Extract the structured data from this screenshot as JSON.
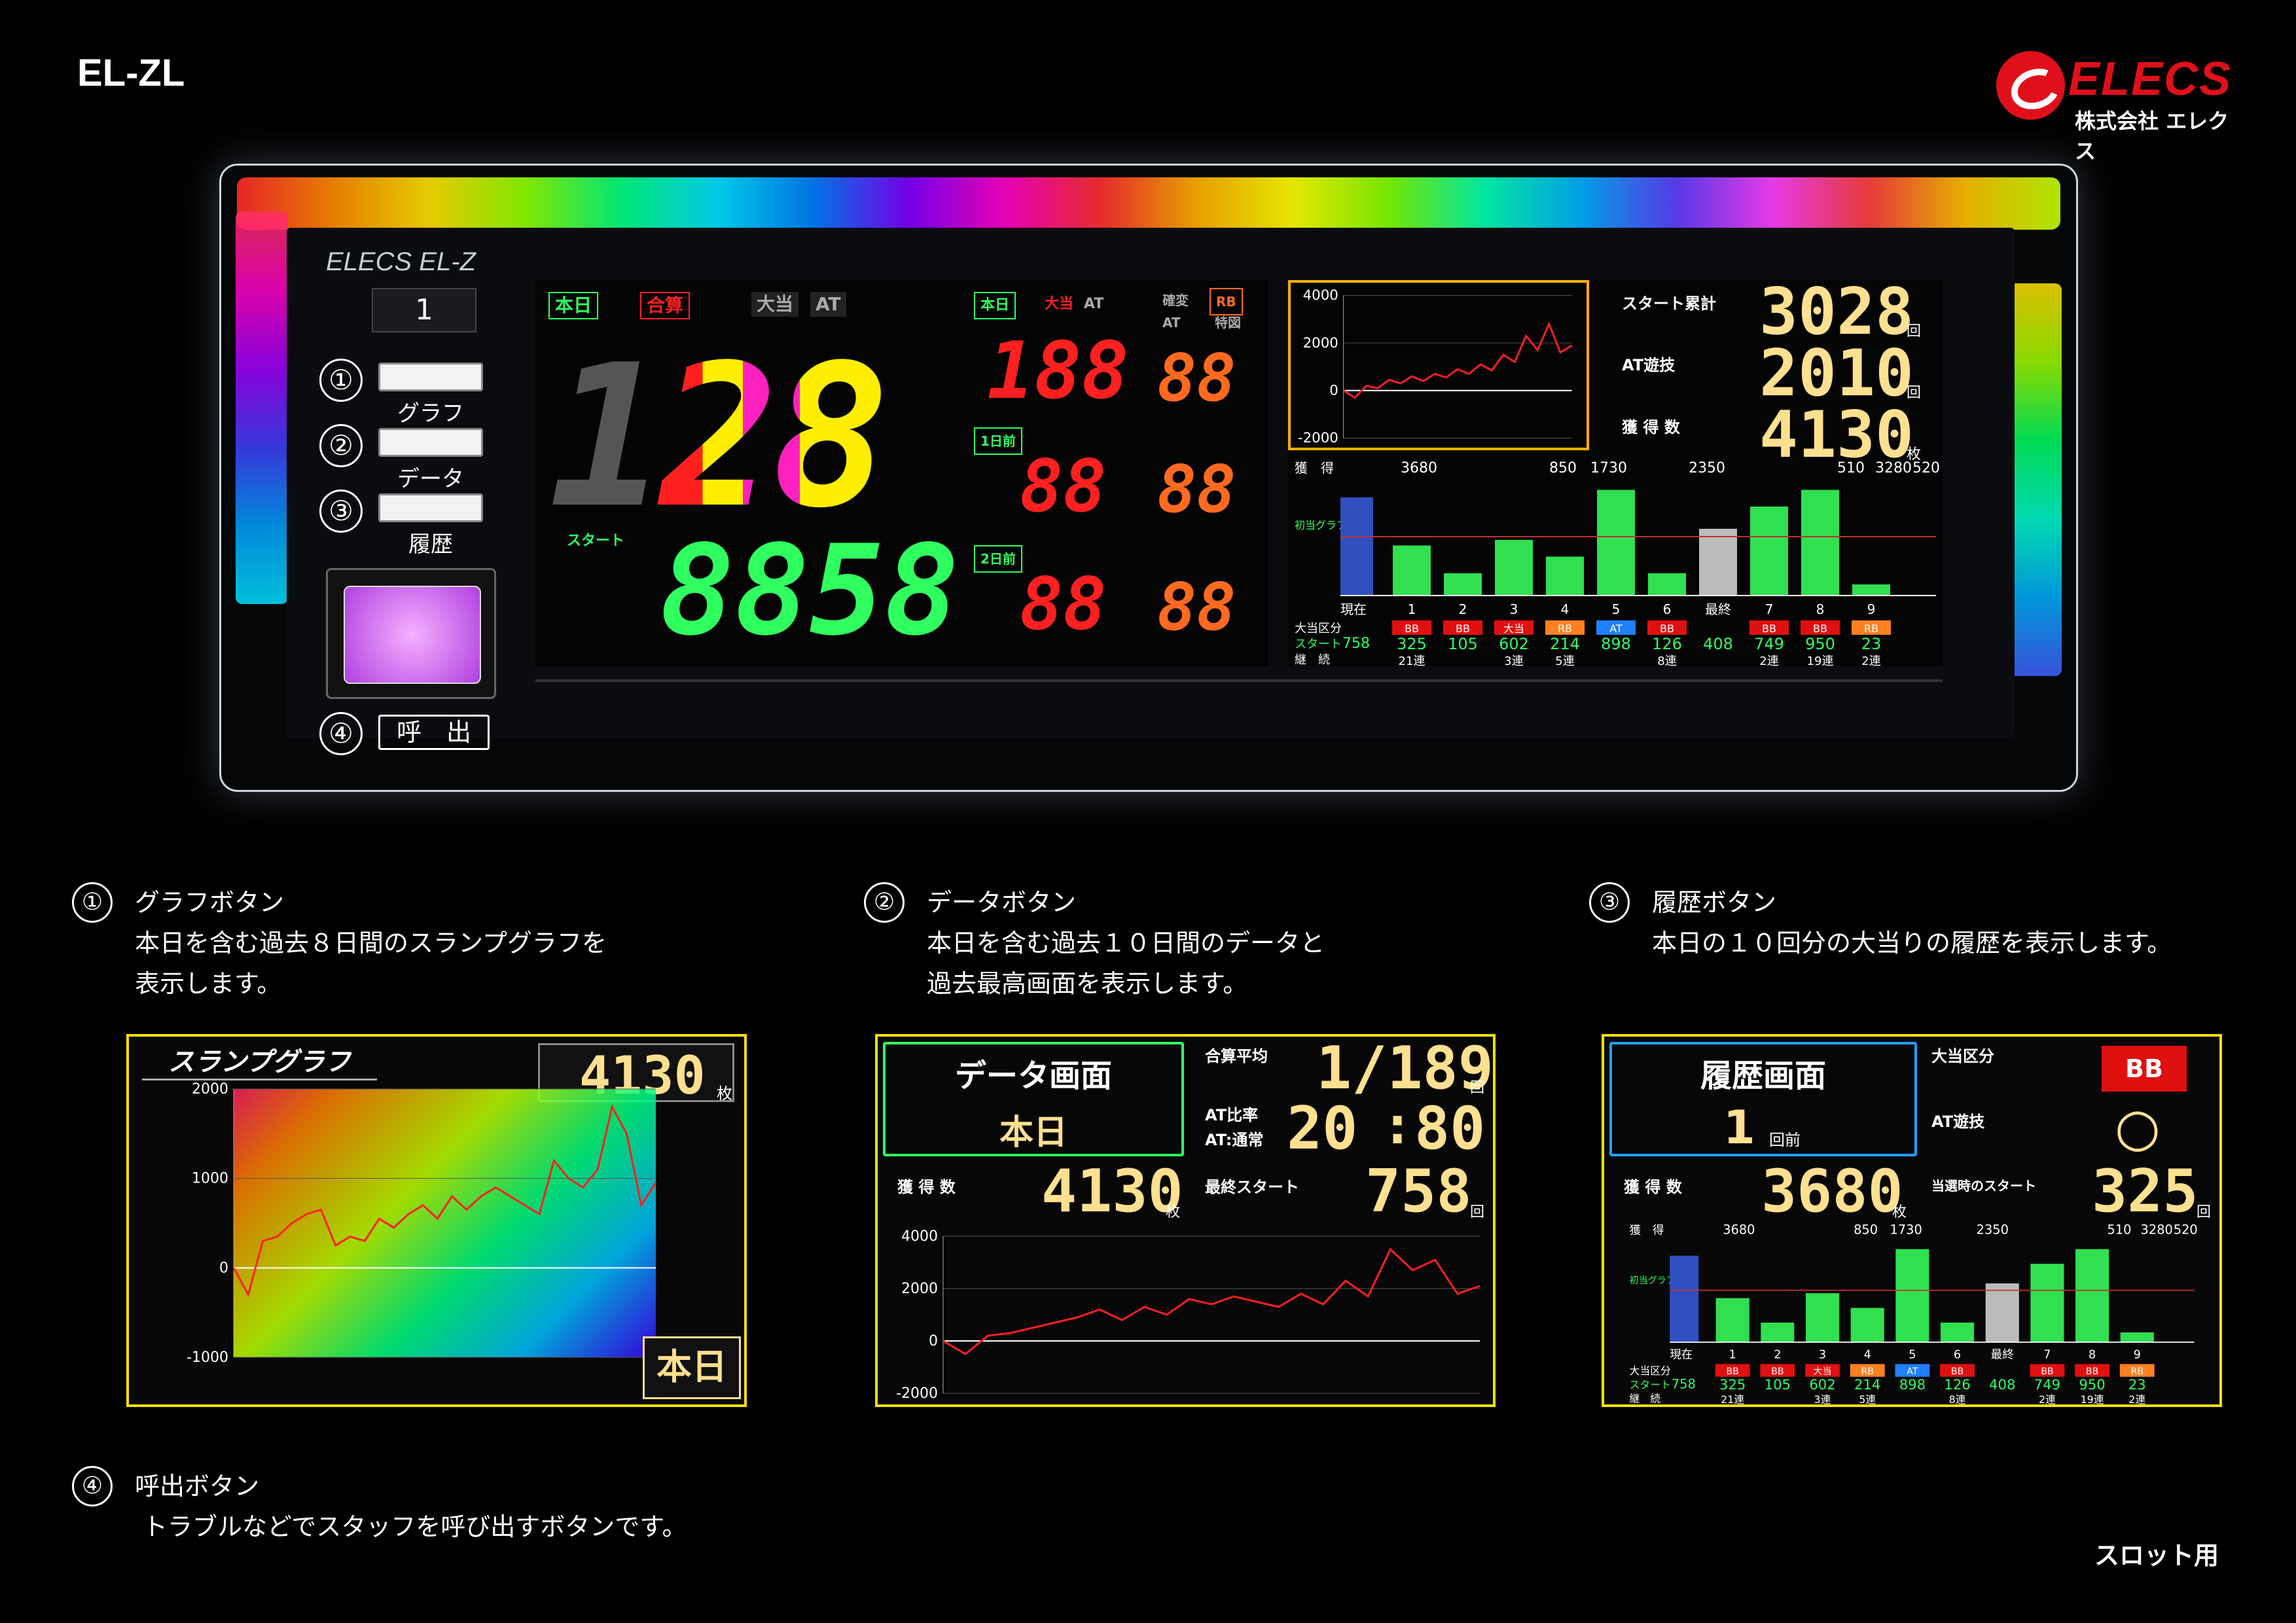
{
  "header": {
    "model": "EL-ZL",
    "logo_word": "ELECS",
    "logo_sub": "株式会社 エレクス"
  },
  "device": {
    "brand": "ELECS EL-Z",
    "unit_number": "1",
    "buttons": [
      {
        "num": "①",
        "label": "グラフ"
      },
      {
        "num": "②",
        "label": "データ"
      },
      {
        "num": "③",
        "label": "履歴"
      }
    ],
    "call": {
      "num": "④",
      "label": "呼　出"
    },
    "main": {
      "tag_today": "本日",
      "tag_total": "合算",
      "tag_big": "大当",
      "tag_at": "AT",
      "big_digits": "128",
      "start_label": "スタート",
      "start_value": "8858",
      "col_today": "本日",
      "col_big": "大当",
      "col_at": "AT",
      "col_kakuhen": "確変",
      "col_rb": "RB",
      "col_at2": "AT",
      "col_tokui": "特図",
      "row1": "1日前",
      "row2": "2日前",
      "r0a": "188",
      "r0b": "88",
      "r1a": "88",
      "r1b": "88",
      "r2a": "88",
      "r2b": "88"
    },
    "right": {
      "chart": {
        "y_ticks": [
          "4000",
          "2000",
          "0",
          "-2000"
        ]
      },
      "start_total_label": "スタート累計",
      "start_total": "3028",
      "start_total_unit": "回",
      "at_label": "AT遊技",
      "at_value": "2010",
      "at_unit": "回",
      "get_label": "獲 得 数",
      "get_value": "4130",
      "get_unit": "枚"
    }
  },
  "history": {
    "row_labels": {
      "get": "獲　得",
      "type": "大当区分",
      "start": "スタート",
      "streak": "継　続",
      "first_hit": "初当グラフ",
      "now": "現在",
      "last": "最終"
    },
    "values_top": [
      "3680",
      "850",
      "1730",
      "2350",
      "510",
      "3280",
      "520"
    ],
    "cols": [
      {
        "n": "1",
        "type": "BB",
        "start": "325",
        "streak": "21連"
      },
      {
        "n": "2",
        "type": "BB",
        "start": "105",
        "streak": ""
      },
      {
        "n": "3",
        "type": "大当",
        "start": "602",
        "streak": "3連"
      },
      {
        "n": "4",
        "type": "RB",
        "start": "214",
        "streak": "5連"
      },
      {
        "n": "5",
        "type": "AT",
        "start": "898",
        "streak": ""
      },
      {
        "n": "6",
        "type": "BB",
        "start": "126",
        "streak": "8連"
      },
      {
        "n": "最終",
        "type": "",
        "start": "408",
        "streak": ""
      },
      {
        "n": "7",
        "type": "BB",
        "start": "749",
        "streak": "2連"
      },
      {
        "n": "8",
        "type": "BB",
        "start": "950",
        "streak": "19連"
      },
      {
        "n": "9",
        "type": "RB",
        "start": "23",
        "streak": "2連"
      }
    ],
    "now_start": "758",
    "bar_levels": [
      0.45,
      0.2,
      0.5,
      0.35,
      0.95,
      0.2,
      0.6,
      0.8,
      0.95,
      0.1
    ]
  },
  "descriptions": [
    {
      "num": "①",
      "title": "グラフボタン",
      "lines": [
        "本日を含む過去８日間のスランプグラフを",
        "表示します。"
      ]
    },
    {
      "num": "②",
      "title": "データボタン",
      "lines": [
        "本日を含む過去１０日間のデータと",
        "過去最高画面を表示します。"
      ]
    },
    {
      "num": "③",
      "title": "履歴ボタン",
      "lines": [
        "本日の１０回分の大当りの履歴を表示します。"
      ]
    },
    {
      "num": "④",
      "title": "呼出ボタン",
      "lines": [
        "トラブルなどでスタッフを呼び出すボタンです。"
      ]
    }
  ],
  "slump": {
    "title": "スランプグラフ",
    "value": "4130",
    "unit": "枚",
    "badge": "本日",
    "y_ticks": [
      "2000",
      "1000",
      "0",
      "-1000"
    ]
  },
  "data_screen": {
    "title": "データ画面",
    "sub": "本日",
    "avg_label": "合算平均",
    "avg_value": "1/189",
    "avg_unit": "回",
    "ratio_label1": "AT比率",
    "ratio_label2": "AT:通常",
    "ratio_a": "20",
    "ratio_sep": ":",
    "ratio_b": "80",
    "get_label": "獲 得 数",
    "get_value": "4130",
    "get_unit": "枚",
    "last_label": "最終スタート",
    "last_value": "758",
    "last_unit": "回",
    "y_ticks": [
      "4000",
      "2000",
      "0",
      "-2000"
    ]
  },
  "hist_screen": {
    "title": "履歴画面",
    "num": "1",
    "num_unit": "回前",
    "type_label": "大当区分",
    "type_value": "BB",
    "at_label": "AT遊技",
    "at_value": "○",
    "get_label": "獲 得 数",
    "get_value": "3680",
    "get_unit": "枚",
    "start_label": "当選時のスタート",
    "start_value": "325",
    "start_unit": "回"
  },
  "footer": {
    "label": "スロット用"
  },
  "colors": {
    "accent_yellow": "#ffe000",
    "led_red": "#ff2020",
    "led_orange": "#ff6a20",
    "led_green": "#30ff60"
  },
  "chart_data": [
    {
      "type": "line",
      "title": "",
      "x": [
        0,
        1,
        2,
        3,
        4,
        5,
        6,
        7,
        8,
        9,
        10,
        11,
        12,
        13,
        14,
        15,
        16,
        17,
        18,
        19,
        20
      ],
      "y": [
        0,
        -300,
        200,
        100,
        450,
        300,
        600,
        400,
        700,
        550,
        900,
        700,
        1100,
        850,
        1500,
        1200,
        2300,
        1700,
        2800,
        1600,
        1900
      ],
      "ylim": [
        -2000,
        4000
      ]
    },
    {
      "type": "line",
      "title": "",
      "x": [
        0,
        1,
        2,
        3,
        4,
        5,
        6,
        7,
        8,
        9,
        10,
        11,
        12,
        13,
        14,
        15,
        16,
        17,
        18,
        19,
        20,
        21,
        22,
        23,
        24,
        25,
        26,
        27,
        28,
        29
      ],
      "y": [
        0,
        -300,
        300,
        350,
        500,
        600,
        650,
        250,
        350,
        300,
        550,
        450,
        600,
        700,
        550,
        800,
        650,
        800,
        900,
        800,
        700,
        600,
        1200,
        1000,
        900,
        1100,
        1800,
        1500,
        700,
        950
      ],
      "ylim": [
        -1000,
        2000
      ]
    },
    {
      "type": "line",
      "title": "",
      "x": [
        0,
        1,
        2,
        3,
        4,
        5,
        6,
        7,
        8,
        9,
        10,
        11,
        12,
        13,
        14,
        15,
        16,
        17,
        18,
        19,
        20,
        21,
        22,
        23,
        24
      ],
      "y": [
        0,
        -500,
        200,
        300,
        500,
        700,
        900,
        1200,
        800,
        1300,
        1000,
        1600,
        1400,
        1700,
        1500,
        1300,
        1800,
        1400,
        2300,
        1700,
        3500,
        2700,
        3100,
        1800,
        2100
      ],
      "ylim": [
        -2000,
        4000
      ]
    }
  ]
}
